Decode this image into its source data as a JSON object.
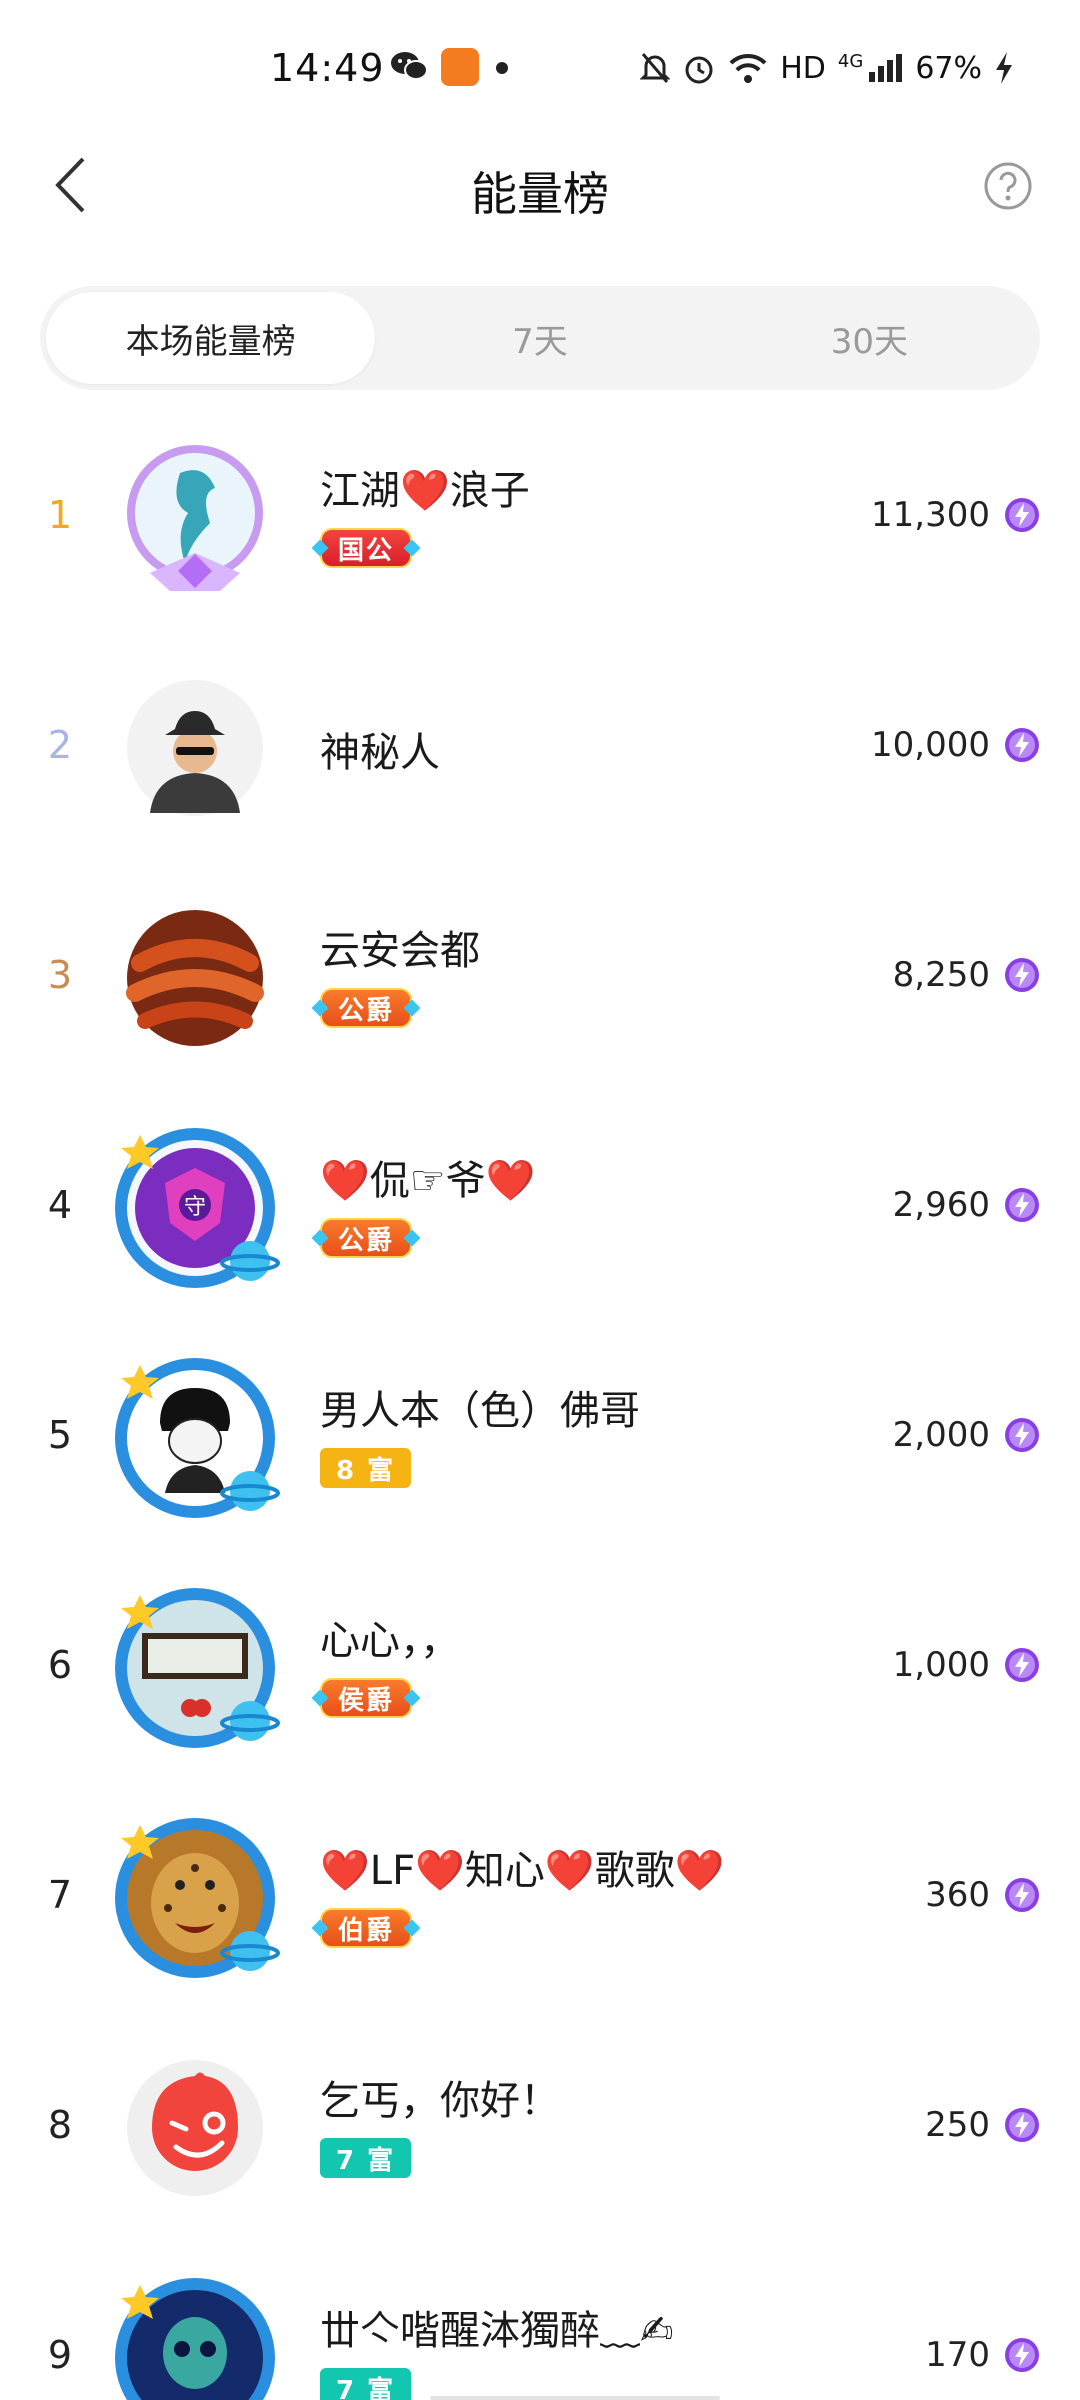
{
  "status_bar": {
    "time": "14:49",
    "network": "HD",
    "signal": "4G",
    "battery": "67%",
    "icons": [
      "wechat-icon",
      "app-icon",
      "dot-icon",
      "mute-bell-icon",
      "alarm-icon",
      "wifi-icon",
      "signal-icon",
      "charging-icon"
    ]
  },
  "header": {
    "title": "能量榜",
    "back_icon": "chevron-left-icon",
    "help_icon": "question-circle-icon"
  },
  "tabs": [
    {
      "label": "本场能量榜",
      "active": true
    },
    {
      "label": "7天",
      "active": false
    },
    {
      "label": "30天",
      "active": false
    }
  ],
  "rankings": [
    {
      "rank": "1",
      "name": "江湖❤️浪子",
      "badge": "国公",
      "score": "11,300"
    },
    {
      "rank": "2",
      "name": "神秘人",
      "badge": "",
      "score": "10,000"
    },
    {
      "rank": "3",
      "name": "云安会都",
      "badge": "公爵",
      "score": "8,250"
    },
    {
      "rank": "4",
      "name": "❤️侃☞爷❤️",
      "badge": "公爵",
      "score": "2,960"
    },
    {
      "rank": "5",
      "name": "男人本（色）佛哥",
      "badge": "8 富",
      "score": "2,000"
    },
    {
      "rank": "6",
      "name": "心心，，",
      "badge": "侯爵",
      "score": "1,000"
    },
    {
      "rank": "7",
      "name": "❤️LF❤️知心❤️歌歌❤️",
      "badge": "伯爵",
      "score": "360"
    },
    {
      "rank": "8",
      "name": "乞丐，你好！",
      "badge": "7 富",
      "score": "250"
    },
    {
      "rank": "9",
      "name": "丗亽喈醒泍獨醉﹏✍",
      "badge": "7 富",
      "score": "170"
    }
  ],
  "colors": {
    "rank1": "#f2a91e",
    "rank2": "#a9b3e6",
    "rank3": "#c98b52",
    "energy": "#8a3fe6",
    "tab_bg": "#f3f3f3"
  }
}
